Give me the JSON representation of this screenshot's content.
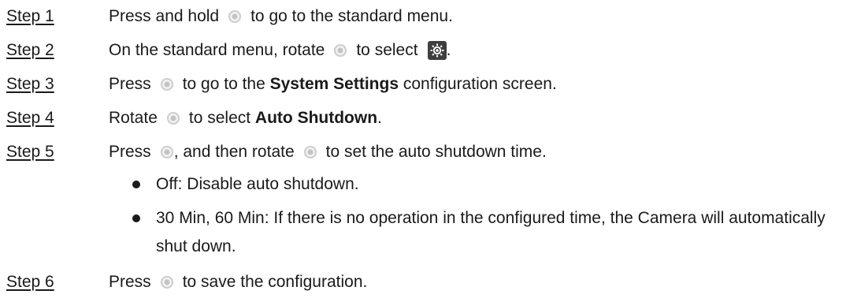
{
  "steps": [
    {
      "label": "Step 1",
      "parts": [
        "Press and hold",
        "to go to the standard menu."
      ]
    },
    {
      "label": "Step 2",
      "parts": [
        "On the standard menu, rotate",
        "to select",
        "."
      ]
    },
    {
      "label": "Step 3",
      "parts": [
        "Press",
        "to go to the",
        "System Settings",
        " configuration screen."
      ]
    },
    {
      "label": "Step 4",
      "parts": [
        "Rotate",
        "to select ",
        "Auto Shutdown",
        "."
      ]
    },
    {
      "label": "Step 5",
      "parts": [
        "Press",
        ", and then rotate",
        "to set the auto shutdown time."
      ]
    },
    {
      "label": "Step 6",
      "parts": [
        "Press",
        "to save the configuration."
      ]
    }
  ],
  "bullets": [
    "Off: Disable auto shutdown.",
    "30 Min, 60 Min: If there is no operation in the configured time, the Camera will automatically shut down."
  ],
  "icons": {
    "knob": "rotary-knob-icon",
    "gear": "settings-gear-icon"
  }
}
